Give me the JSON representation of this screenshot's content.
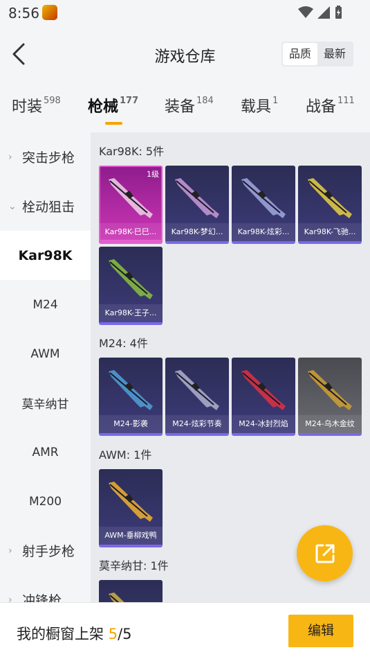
{
  "status": {
    "time": "8:56",
    "app_icon_text": "和平精英"
  },
  "header": {
    "title": "游戏仓库",
    "sort": [
      "品质",
      "最新"
    ]
  },
  "tabs": [
    {
      "label": "时装",
      "count": "598"
    },
    {
      "label": "枪械",
      "count": "177"
    },
    {
      "label": "装备",
      "count": "184"
    },
    {
      "label": "载具",
      "count": "1"
    },
    {
      "label": "战备",
      "count": "111"
    }
  ],
  "sidebar": [
    {
      "label": "突击步枪",
      "type": "group",
      "chevron": "›"
    },
    {
      "label": "栓动狙击",
      "type": "group",
      "chevron": "⌄"
    },
    {
      "label": "Kar98K",
      "type": "item"
    },
    {
      "label": "M24",
      "type": "item"
    },
    {
      "label": "AWM",
      "type": "item"
    },
    {
      "label": "莫辛纳甘",
      "type": "item"
    },
    {
      "label": "AMR",
      "type": "item"
    },
    {
      "label": "M200",
      "type": "item"
    },
    {
      "label": "射手步枪",
      "type": "group",
      "chevron": "›"
    },
    {
      "label": "冲锋枪",
      "type": "group",
      "chevron": "›"
    }
  ],
  "sections": [
    {
      "title": "Kar98K: 5件",
      "items": [
        {
          "name": "Kar98K-巳巳...",
          "level": "1级",
          "rarity": "pink",
          "accent": "#f0d0e8"
        },
        {
          "name": "Kar98K-梦幻...",
          "rarity": "purple",
          "accent": "#c89ad8"
        },
        {
          "name": "Kar98K-炫彩...",
          "rarity": "purple",
          "accent": "#a0a8e0"
        },
        {
          "name": "Kar98K-飞驰...",
          "rarity": "purple",
          "accent": "#e8d040"
        },
        {
          "name": "Kar98K-王子...",
          "rarity": "purple",
          "accent": "#8ac040"
        }
      ]
    },
    {
      "title": "M24: 4件",
      "items": [
        {
          "name": "M24-影袭",
          "rarity": "purple",
          "accent": "#50a0d8"
        },
        {
          "name": "M24-炫彩节奏",
          "rarity": "purple",
          "accent": "#b0b0d0"
        },
        {
          "name": "M24-冰封烈焰",
          "rarity": "purple",
          "accent": "#e03040"
        },
        {
          "name": "M24-乌木金纹",
          "rarity": "gray",
          "accent": "#d0a030"
        }
      ]
    },
    {
      "title": "AWM: 1件",
      "items": [
        {
          "name": "AWM-垂柳戏鸭",
          "rarity": "purple",
          "accent": "#f0b030"
        }
      ]
    },
    {
      "title": "莫辛纳甘: 1件",
      "items": [
        {
          "name": "",
          "rarity": "purple",
          "accent": "#d0b040"
        }
      ]
    }
  ],
  "bottom": {
    "label": "我的橱窗上架",
    "current": "5",
    "total": "/5",
    "edit_label": "编辑"
  }
}
